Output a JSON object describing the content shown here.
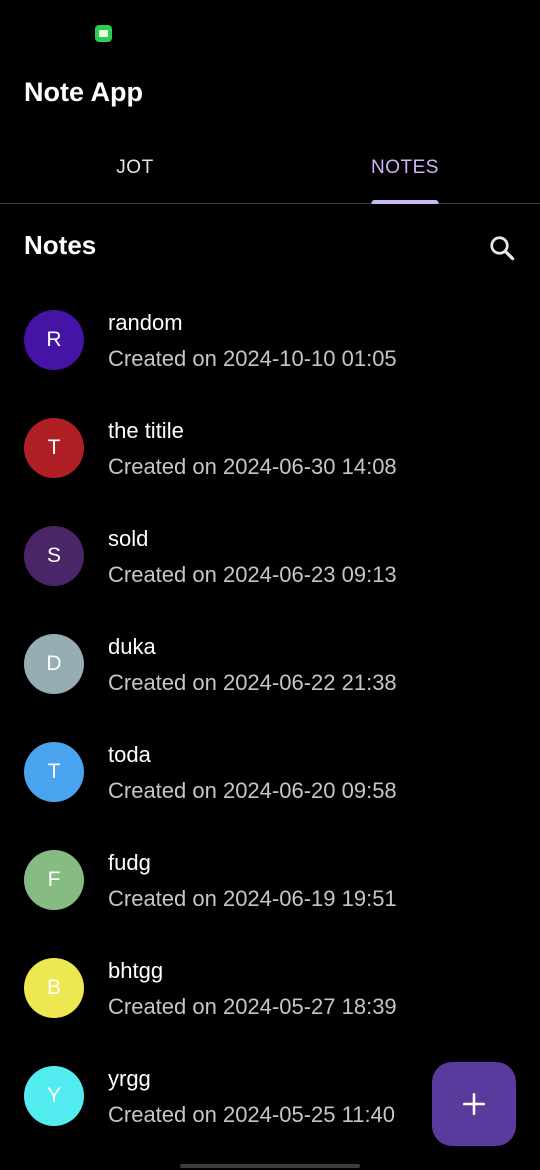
{
  "status_bar": {
    "icon": "message-app-icon",
    "icon_color": "#2ecc4f"
  },
  "app": {
    "title": "Note App"
  },
  "tabs": [
    {
      "label": "JOT",
      "active": false
    },
    {
      "label": "NOTES",
      "active": true
    }
  ],
  "accent_color": "#cdb7f5",
  "section": {
    "title": "Notes",
    "search_icon": "search-icon"
  },
  "notes": [
    {
      "initial": "R",
      "title": "random",
      "date": "Created on 2024-10-10 01:05",
      "color": "#4514a6"
    },
    {
      "initial": "T",
      "title": "the titile",
      "date": "Created on 2024-06-30 14:08",
      "color": "#b11f26"
    },
    {
      "initial": "S",
      "title": "sold",
      "date": "Created on 2024-06-23 09:13",
      "color": "#4a2668"
    },
    {
      "initial": "D",
      "title": "duka",
      "date": "Created on 2024-06-22 21:38",
      "color": "#95adb3"
    },
    {
      "initial": "T",
      "title": "toda",
      "date": "Created on 2024-06-20 09:58",
      "color": "#4aa3ef"
    },
    {
      "initial": "F",
      "title": "fudg",
      "date": "Created on 2024-06-19 19:51",
      "color": "#86bb84"
    },
    {
      "initial": "B",
      "title": "bhtgg",
      "date": "Created on 2024-05-27 18:39",
      "color": "#ede84f"
    },
    {
      "initial": "Y",
      "title": "yrgg",
      "date": "Created on 2024-05-25 11:40",
      "color": "#52ecf0"
    }
  ],
  "fab": {
    "icon": "plus-icon",
    "color": "#5b3a9e"
  }
}
